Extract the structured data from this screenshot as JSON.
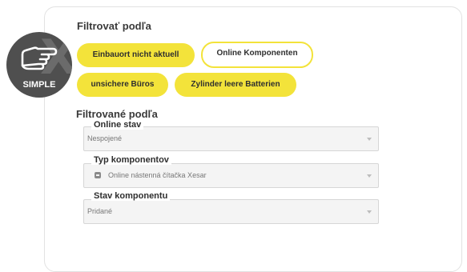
{
  "filter_section": {
    "title": "Filtrovať podľa",
    "chips": [
      {
        "label": "Einbauort nicht aktuell"
      },
      {
        "label": "Online Komponenten"
      },
      {
        "label": "unsichere Büros"
      },
      {
        "label": "Zylinder leere Batterien"
      }
    ]
  },
  "filtered_section": {
    "title": "Filtrované podľa",
    "fields": [
      {
        "label": "Online stav",
        "value": "Nespojené"
      },
      {
        "label": "Typ komponentov",
        "value": "Online nástenná čítačka Xesar"
      },
      {
        "label": "Stav komponentu",
        "value": "Pridané"
      }
    ]
  },
  "badge": {
    "label": "SIMPLE",
    "icon": "hand-pointing-icon"
  },
  "colors": {
    "chip_yellow": "#f3e33a",
    "badge_gray": "#4f4f4f"
  }
}
